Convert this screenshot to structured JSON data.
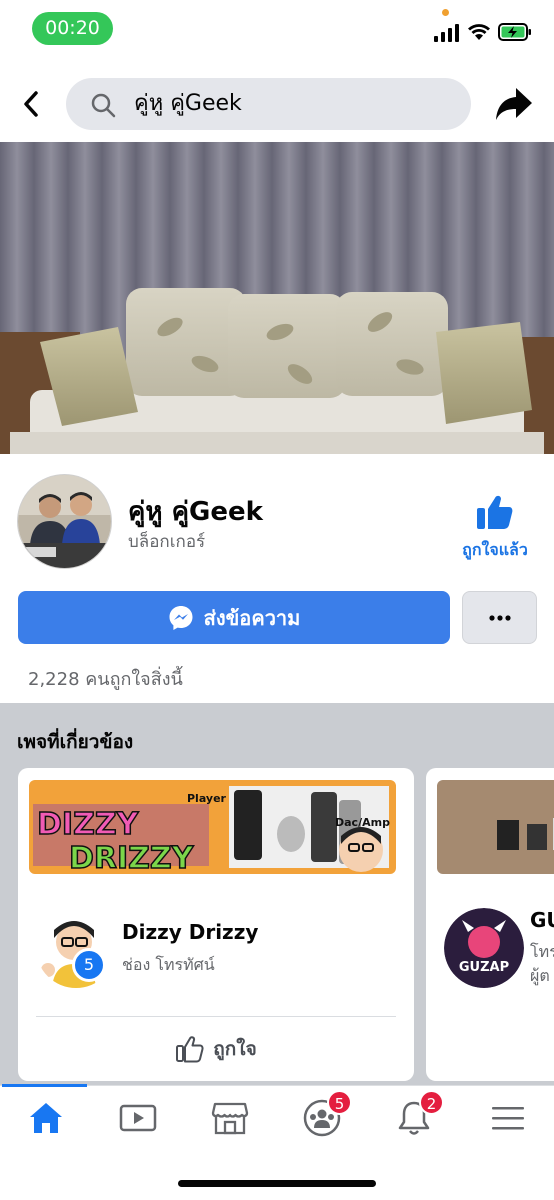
{
  "status_bar": {
    "time": "00:20",
    "icons": [
      "signal-icon",
      "wifi-icon",
      "battery-charging-icon"
    ]
  },
  "top_bar": {
    "back_icon": "chevron-left-icon",
    "search_icon": "search-icon",
    "search_value": "คู่หู คู่Geek",
    "share_icon": "share-arrow-icon"
  },
  "page": {
    "name": "คู่หู คู่Geek",
    "category": "บล็อกเกอร์",
    "liked_label": "ถูกใจแล้ว",
    "message_label": "ส่งข้อความ",
    "more_label": "•••",
    "likes_text": "2,228 คนถูกใจสิ่งนี้"
  },
  "related": {
    "title": "เพจที่เกี่ยวข้อง",
    "cards": [
      {
        "banner_text_1": "DIZZY",
        "banner_text_2": "DRIZZY",
        "banner_tag_1": "Player",
        "banner_tag_2": "Dac/Amp",
        "name": "Dizzy Drizzy",
        "category": "ช่อง โทรทัศน์",
        "badge": "5",
        "like_label": "ถูกใจ"
      },
      {
        "name": "GU",
        "category": "โทร",
        "category_2": "ผู้ต",
        "logo_text": "GUZAP"
      }
    ]
  },
  "bottom_nav": {
    "items": [
      {
        "icon": "home-icon",
        "active": true
      },
      {
        "icon": "watch-video-icon"
      },
      {
        "icon": "marketplace-icon"
      },
      {
        "icon": "groups-icon",
        "badge": "5"
      },
      {
        "icon": "notifications-bell-icon",
        "badge": "2"
      },
      {
        "icon": "menu-icon"
      }
    ]
  },
  "colors": {
    "accent": "#1877f2",
    "message_button": "#3b7ee9",
    "badge": "#e41e3f",
    "status_time": "#34c759"
  }
}
